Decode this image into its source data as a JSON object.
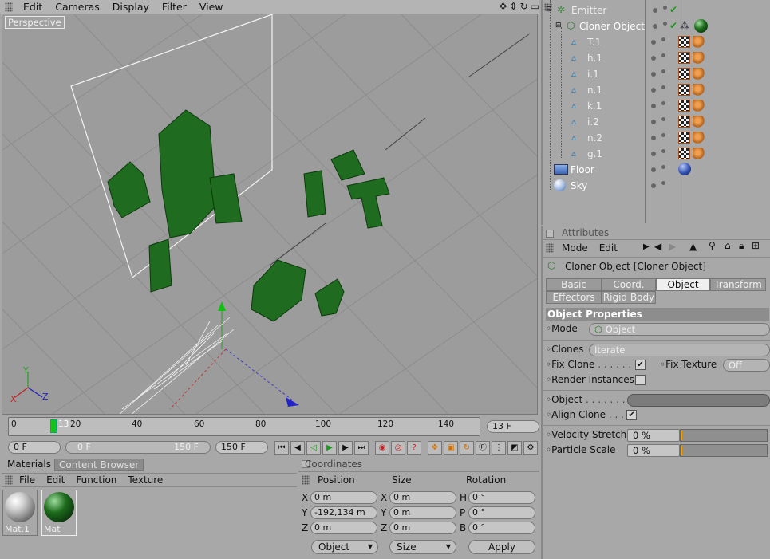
{
  "menubar": {
    "items": [
      "Edit",
      "Cameras",
      "Display",
      "Filter",
      "View"
    ]
  },
  "viewport": {
    "label": "Perspective",
    "axis_labels": {
      "y": "Y",
      "z": "Z",
      "x": "X"
    },
    "letters_color": "#1f6b1f"
  },
  "timeline": {
    "ticks": [
      "0",
      "13",
      "20",
      "40",
      "60",
      "80",
      "100",
      "120",
      "140"
    ],
    "current_frame": "13 F",
    "current_frame_value": 13
  },
  "transport": {
    "start_field": "0 F",
    "range_start": "0 F",
    "range_end": "150 F",
    "end_field": "150 F"
  },
  "materials": {
    "tabs": [
      "Materials",
      "Content Browser"
    ],
    "menu": [
      "File",
      "Edit",
      "Function",
      "Texture"
    ],
    "swatches": [
      {
        "label": "Mat.1",
        "color": "#c8c8c8"
      },
      {
        "label": "Mat",
        "color": "#1d6b1d"
      }
    ]
  },
  "coordinates": {
    "title": "Coordinates",
    "headers": [
      "Position",
      "Size",
      "Rotation"
    ],
    "position": [
      {
        "axis": "X",
        "value": "0 m"
      },
      {
        "axis": "Y",
        "value": "-192,134 m"
      },
      {
        "axis": "Z",
        "value": "0 m"
      }
    ],
    "size": [
      {
        "axis": "X",
        "value": "0 m"
      },
      {
        "axis": "Y",
        "value": "0 m"
      },
      {
        "axis": "Z",
        "value": "0 m"
      }
    ],
    "rotation": [
      {
        "axis": "H",
        "value": "0 °"
      },
      {
        "axis": "P",
        "value": "0 °"
      },
      {
        "axis": "B",
        "value": "0 °"
      }
    ],
    "mode_select": "Object",
    "size_select": "Size",
    "apply_label": "Apply"
  },
  "object_manager": {
    "rows": [
      {
        "name": "Emitter",
        "dim": true
      },
      {
        "name": "Cloner Object",
        "dim": false
      },
      {
        "name": "T.1",
        "dim": true
      },
      {
        "name": "h.1",
        "dim": true
      },
      {
        "name": "i.1",
        "dim": true
      },
      {
        "name": "n.1",
        "dim": true
      },
      {
        "name": "k.1",
        "dim": true
      },
      {
        "name": "i.2",
        "dim": true
      },
      {
        "name": "n.2",
        "dim": true
      },
      {
        "name": "g.1",
        "dim": true
      },
      {
        "name": "Floor",
        "dim": false
      },
      {
        "name": "Sky",
        "dim": false
      }
    ]
  },
  "attributes": {
    "title": "Attributes",
    "menu": [
      "Mode",
      "Edit"
    ],
    "object_title": "Cloner Object [Cloner Object]",
    "tabs_row1": [
      "Basic",
      "Coord.",
      "Object",
      "Transform"
    ],
    "tabs_row2": [
      "Effectors",
      "Rigid Body"
    ],
    "active_tab": "Object",
    "section": "Object Properties",
    "mode_label": "Mode",
    "mode_value": "Object",
    "clones_label": "Clones",
    "clones_value": "Iterate",
    "fix_clone_label": "Fix Clone",
    "fix_texture_label": "Fix Texture",
    "fix_texture_value": "Off",
    "render_instances_label": "Render Instances",
    "object_label": "Object",
    "align_clone_label": "Align Clone",
    "velocity_label": "Velocity Stretch",
    "velocity_value": "0 %",
    "particle_label": "Particle Scale",
    "particle_value": "0 %"
  }
}
